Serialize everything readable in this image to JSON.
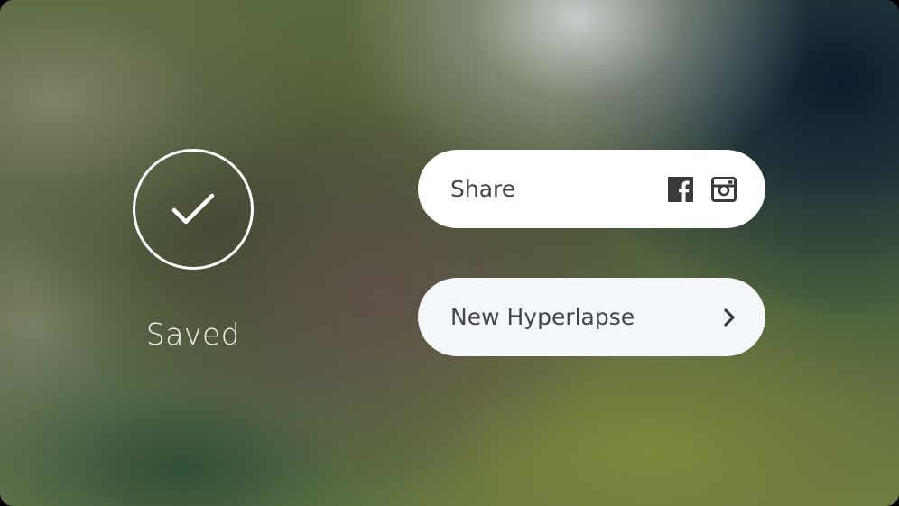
{
  "status": {
    "label": "Saved",
    "icon": "checkmark-icon"
  },
  "actions": {
    "share": {
      "label": "Share",
      "icons": [
        "facebook-icon",
        "instagram-icon"
      ]
    },
    "new_hyperlapse": {
      "label": "New Hyperlapse",
      "icon": "chevron-right-icon"
    }
  },
  "colors": {
    "pill_background": "#ffffff",
    "pill_text": "#454545",
    "icon_dark": "#3a3a3a",
    "saved_text": "#f4f4f4"
  }
}
